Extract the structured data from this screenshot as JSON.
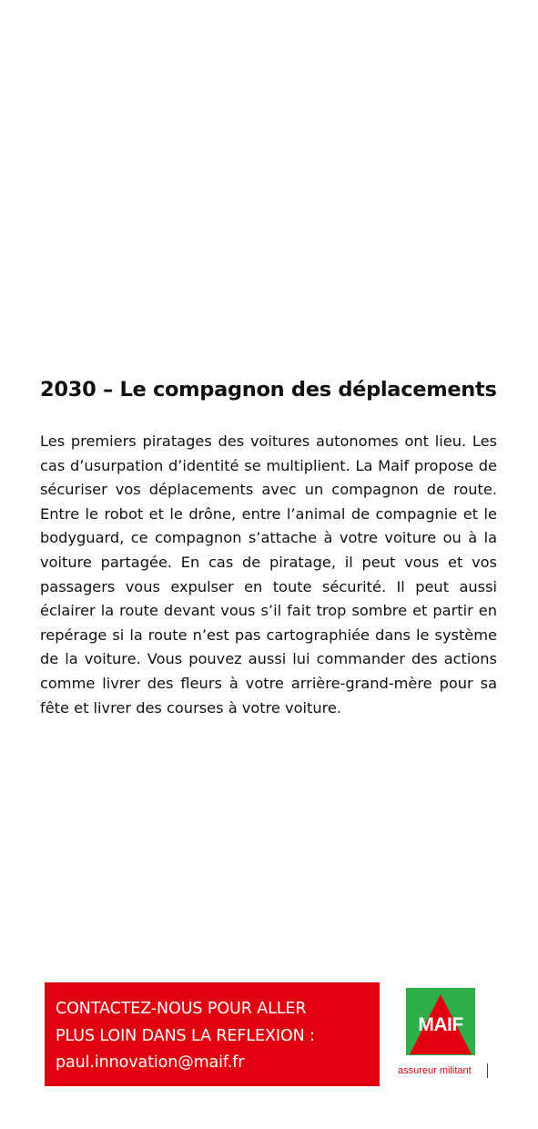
{
  "article": {
    "title": "2030 – Le compagnon des déplacements",
    "body": "Les premiers piratages des voitures autonomes ont lieu. Les cas d’usurpation d’identité se multiplient. La Maif propose de sécuriser vos déplacements avec un compagnon de route. Entre le robot et le drône, entre l’animal de compagnie et le bodyguard, ce compagnon s’attache à votre voiture ou à la voiture partagée. En cas de piratage, il peut vous et vos passagers vous expulser en toute sécurité. Il peut aussi éclairer la route devant vous s’il fait trop sombre et partir en repérage si la route n’est pas cartographiée dans le système de la voiture. Vous pouvez aussi lui commander des actions comme livrer des fleurs à votre arrière-grand-mère pour sa fête et livrer des courses à votre voiture."
  },
  "contact": {
    "line1": "CONTACTEZ-NOUS POUR ALLER",
    "line2": "PLUS LOIN DANS LA REFLEXION :",
    "email": "paul.innovation@maif.fr"
  },
  "brand": {
    "logo_text": "MAIF",
    "tagline": "assureur militant",
    "logo_icon": "maif-triangle-logo",
    "colors": {
      "red": "#e00010",
      "green": "#2fae4a",
      "tagline": "#d40010"
    }
  }
}
